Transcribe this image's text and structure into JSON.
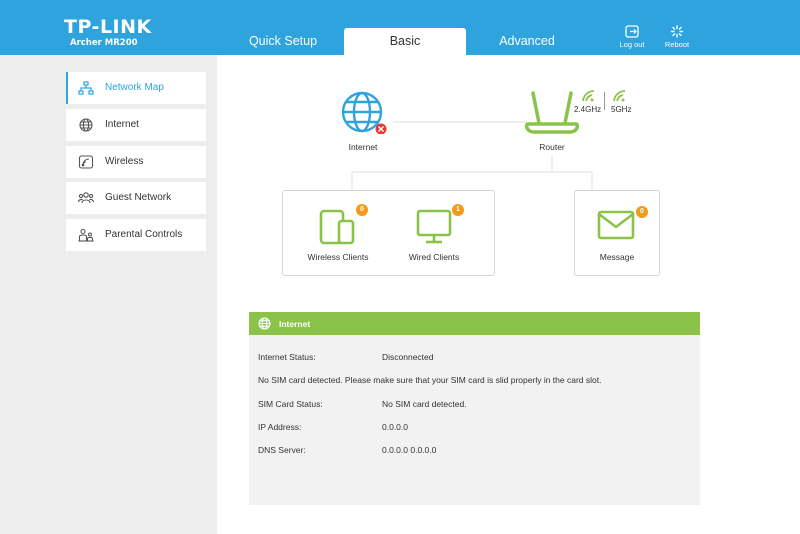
{
  "brand": {
    "name": "TP-LINK",
    "model": "Archer MR200"
  },
  "tabs": {
    "quick_setup": "Quick Setup",
    "basic": "Basic",
    "advanced": "Advanced"
  },
  "header_buttons": {
    "logout": "Log out",
    "reboot": "Reboot"
  },
  "sidebar": {
    "items": [
      {
        "label": "Network Map",
        "icon": "network-map-icon",
        "active": true
      },
      {
        "label": "Internet",
        "icon": "globe-icon",
        "active": false
      },
      {
        "label": "Wireless",
        "icon": "wireless-icon",
        "active": false
      },
      {
        "label": "Guest Network",
        "icon": "guest-network-icon",
        "active": false
      },
      {
        "label": "Parental Controls",
        "icon": "parental-controls-icon",
        "active": false
      }
    ]
  },
  "network_map": {
    "internet_label": "Internet",
    "router_label": "Router",
    "band_24": "2.4GHz",
    "band_5": "5GHz",
    "wireless_clients": {
      "label": "Wireless Clients",
      "count": "0"
    },
    "wired_clients": {
      "label": "Wired Clients",
      "count": "1"
    },
    "message": {
      "label": "Message",
      "count": "0"
    }
  },
  "internet_panel": {
    "title": "Internet",
    "status_label": "Internet Status:",
    "status_value": "Disconnected",
    "notice": "No SIM card detected. Please make sure that your SIM card is slid properly in the card slot.",
    "sim_label": "SIM Card Status:",
    "sim_value": "No SIM card detected.",
    "ip_label": "IP Address:",
    "ip_value": "0.0.0.0",
    "dns_label": "DNS Server:",
    "dns_value": "0.0.0.0 0.0.0.0"
  },
  "colors": {
    "header": "#2ea3de",
    "accent_green": "#8bc34a",
    "badge": "#f39a1d",
    "error": "#e53935",
    "sidebar_bg": "#ededed"
  }
}
